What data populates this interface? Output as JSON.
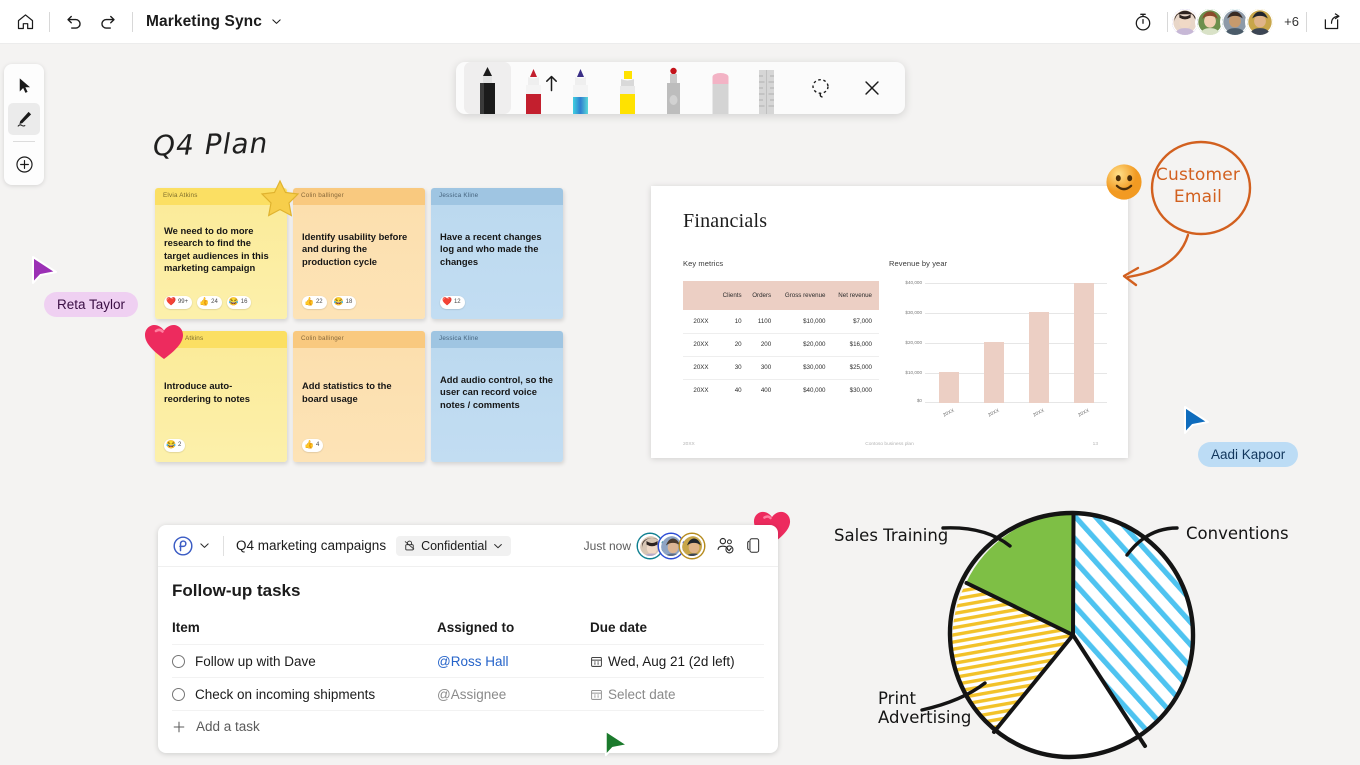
{
  "topbar": {
    "home_icon": "home-icon",
    "undo_icon": "undo-icon",
    "redo_icon": "redo-icon",
    "title": "Marketing Sync",
    "title_chevron": "chevron-down-icon",
    "timer_icon": "timer-icon",
    "share_icon": "share-icon",
    "overflow_count": "+6",
    "avatars": [
      {
        "name": "participant-1",
        "ring": "#6b4fc0"
      },
      {
        "name": "participant-2",
        "ring": "#2f7a32"
      },
      {
        "name": "participant-3",
        "ring": "#0e7f90"
      },
      {
        "name": "participant-4",
        "ring": "#c9a227"
      }
    ]
  },
  "rail": {
    "items": [
      {
        "name": "select-tool",
        "icon": "cursor-icon",
        "selected": false
      },
      {
        "name": "ink-tool",
        "icon": "pen-icon",
        "selected": true
      },
      {
        "name": "add-tool",
        "icon": "plus-circle-icon",
        "selected": false
      }
    ]
  },
  "pentoolbar": {
    "pens": [
      {
        "name": "pen-black",
        "label": "Black pen",
        "body": "#1b1b1b",
        "selected": true,
        "arrow": false
      },
      {
        "name": "pen-red",
        "label": "Red pen",
        "body": "#d21b2d",
        "selected": false,
        "arrow": true
      },
      {
        "name": "pen-blue",
        "label": "Blue gradient pen",
        "body": "#29b6d8",
        "selected": false,
        "arrow": false
      },
      {
        "name": "highlighter-yellow",
        "label": "Yellow highlighter",
        "body": "#ffe200",
        "selected": false,
        "arrow": false
      },
      {
        "name": "pen-grey-dot",
        "label": "Grey pen",
        "body": "#c9c9c9",
        "selected": false,
        "arrow": false
      },
      {
        "name": "eraser-pink",
        "label": "Eraser",
        "body": "#d9d9d9",
        "selected": false,
        "arrow": false
      },
      {
        "name": "ruler",
        "label": "Ruler",
        "body": "#cfcfcf",
        "selected": false,
        "arrow": false
      }
    ],
    "lasso_icon": "lasso-select-icon",
    "close_icon": "close-icon"
  },
  "canvas": {
    "title": "Q4 Plan",
    "notes": [
      {
        "author": "Elvia Atkins",
        "text": "We need to do more research to find the target audiences in this marketing campaign",
        "color": "yellow",
        "reactions": [
          {
            "emoji": "❤️",
            "count": "99+"
          },
          {
            "emoji": "👍",
            "count": "24"
          },
          {
            "emoji": "😂",
            "count": "16"
          }
        ]
      },
      {
        "author": "Colin ballinger",
        "text": "Identify usability before and during the production cycle",
        "color": "orange",
        "reactions": [
          {
            "emoji": "👍",
            "count": "22"
          },
          {
            "emoji": "😂",
            "count": "18"
          }
        ]
      },
      {
        "author": "Jessica Kline",
        "text": "Have a recent changes log and who made the changes",
        "color": "blue",
        "reactions": [
          {
            "emoji": "❤️",
            "count": "12"
          }
        ]
      },
      {
        "author": "Atkins",
        "text": "Introduce auto-reordering to notes",
        "color": "yellow",
        "reactions": [
          {
            "emoji": "😂",
            "count": "2"
          }
        ]
      },
      {
        "author": "Colin ballinger",
        "text": "Add statistics to the board usage",
        "color": "orange",
        "reactions": [
          {
            "emoji": "👍",
            "count": "4"
          }
        ]
      },
      {
        "author": "Jessica Kline",
        "text": "Add audio control, so the user can record voice notes / comments",
        "color": "blue",
        "reactions": []
      }
    ],
    "annotation": {
      "line1": "Customer",
      "line2": "Email",
      "color": "#d2601f",
      "emoji": "🙂"
    },
    "cursors": [
      {
        "name": "Reta Taylor",
        "color": "#9b30b5",
        "bg": "#efd0f2",
        "text": "#3a0e44"
      },
      {
        "name": "Aadi Kapoor",
        "color": "#0f6cbd",
        "bg": "#bcdcf5",
        "text": "#11365c"
      }
    ]
  },
  "slide": {
    "title": "Financials",
    "table_caption": "Key metrics",
    "chart_caption": "Revenue by year",
    "footer_left": "20XX",
    "footer_center": "Contoso business plan",
    "footer_right": "13"
  },
  "chart_data": [
    {
      "type": "table",
      "title": "Key metrics",
      "columns": [
        "",
        "Clients",
        "Orders",
        "Gross revenue",
        "Net revenue"
      ],
      "rows": [
        [
          "20XX",
          "10",
          "1100",
          "$10,000",
          "$7,000"
        ],
        [
          "20XX",
          "20",
          "200",
          "$20,000",
          "$16,000"
        ],
        [
          "20XX",
          "30",
          "300",
          "$30,000",
          "$25,000"
        ],
        [
          "20XX",
          "40",
          "400",
          "$40,000",
          "$30,000"
        ]
      ]
    },
    {
      "type": "bar",
      "title": "Revenue by year",
      "categories": [
        "20XX",
        "20XX",
        "20XX",
        "20XX"
      ],
      "values": [
        10000,
        20000,
        30000,
        40000
      ],
      "ytick_labels": [
        "$0",
        "$10,000",
        "$20,000",
        "$30,000",
        "$40,000"
      ],
      "ylim": [
        0,
        40000
      ],
      "xlabel": "",
      "ylabel": "",
      "grid": true,
      "legend": "none",
      "bar_color": "#eccfc4"
    },
    {
      "type": "pie",
      "title": "",
      "labels": [
        "Conventions",
        "Print Advertising",
        "Sales Training",
        ""
      ],
      "values": [
        40,
        24,
        20,
        16
      ],
      "slice_labels": [
        "40%",
        "24%",
        "20%",
        "16%"
      ],
      "colors": [
        "#4ec3f0",
        "#ffffff",
        "#f2c229",
        "#7ebf45"
      ],
      "style": "hand-drawn"
    }
  ],
  "taskcard": {
    "app_icon": "loop-icon",
    "app_chevron": "chevron-down-icon",
    "component_name": "Q4 marketing campaigns",
    "sensitivity_icon": "lock-icon",
    "sensitivity": "Confidential",
    "sensitivity_chevron": "chevron-down-icon",
    "saved_status": "Just now",
    "people_icon": "people-check-icon",
    "device_icon": "mobile-icon",
    "avatars": [
      {
        "name": "task-participant-1",
        "ring": "#0e7f90"
      },
      {
        "name": "task-participant-2",
        "ring": "#2b4bd6"
      },
      {
        "name": "task-participant-3",
        "ring": "#b58a1c"
      }
    ],
    "title": "Follow-up tasks",
    "headers": {
      "item": "Item",
      "assigned": "Assigned to",
      "due": "Due date"
    },
    "tasks": [
      {
        "item": "Follow up with Dave",
        "assigned": "@Ross Hall",
        "assigned_filled": true,
        "due": "Wed, Aug 21 (2d left)",
        "due_filled": true,
        "due_icon": "calendar-icon"
      },
      {
        "item": "Check on incoming shipments",
        "assigned": "@Assignee",
        "assigned_filled": false,
        "due": "Select date",
        "due_filled": false,
        "due_icon": "calendar-icon"
      }
    ],
    "add_label": "Add a task",
    "add_icon": "plus-icon"
  },
  "pie_labels": {
    "sales_training": "Sales Training",
    "conventions": "Conventions",
    "print_advertising": "Print\nAdvertising",
    "p40": "40%",
    "p24": "24%",
    "p20": "20%",
    "p16": "16%"
  }
}
